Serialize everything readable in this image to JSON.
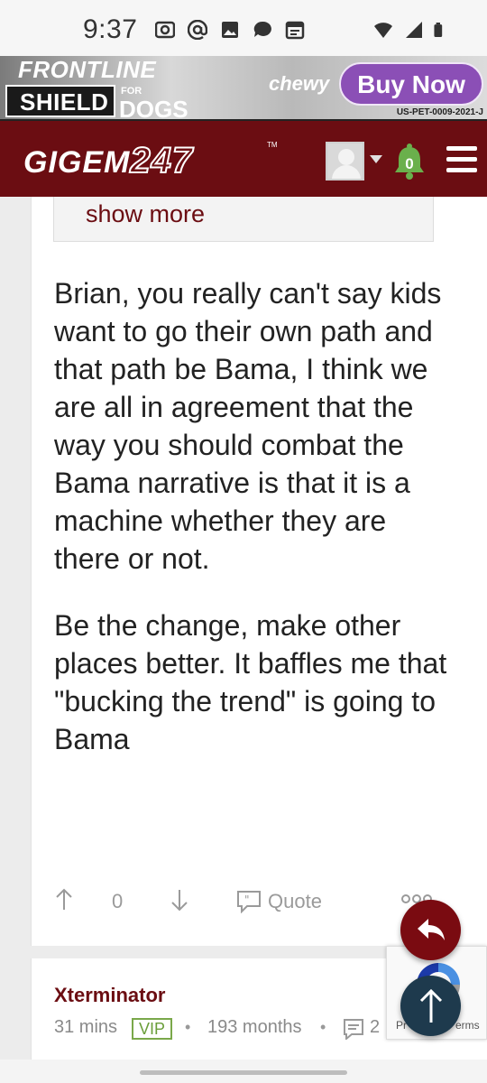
{
  "status_bar": {
    "time": "9:37",
    "icons": [
      "radio-icon",
      "at-icon",
      "image-icon",
      "chat-icon",
      "calendar-icon",
      "wifi-icon",
      "signal-icon",
      "battery-icon"
    ]
  },
  "ad": {
    "brand_line1": "FRONTLINE",
    "brand_line2": "SHIELD",
    "brand_for": "FOR",
    "brand_dogs": "DOGS",
    "retailer": "chewy",
    "cta": "Buy Now",
    "code": "US-PET-0009-2021-J"
  },
  "navbar": {
    "logo_text": "GIGEM",
    "logo_number": "247",
    "trademark": "TM",
    "notification_count": "0",
    "background": "#6b0d12"
  },
  "post": {
    "show_more": "show more",
    "paragraphs": [
      "Brian, you really can't say kids want to go their own path and that path be Bama, I think we are all in agreement that the way you should combat the Bama narrative is that it is a machine whether they are there or not.",
      "Be the change, make other places better. It baffles me that \"bucking the trend\" is going to Bama"
    ],
    "vote_count": "0",
    "quote_label": "Quote"
  },
  "next_post": {
    "author": "Xterminator",
    "time_ago": "31 mins",
    "badge": "VIP",
    "tenure": "193 months",
    "separator": "•",
    "reply_count_partial": "2"
  },
  "recaptcha": {
    "text_left": "Pr",
    "text_right": "erms"
  }
}
